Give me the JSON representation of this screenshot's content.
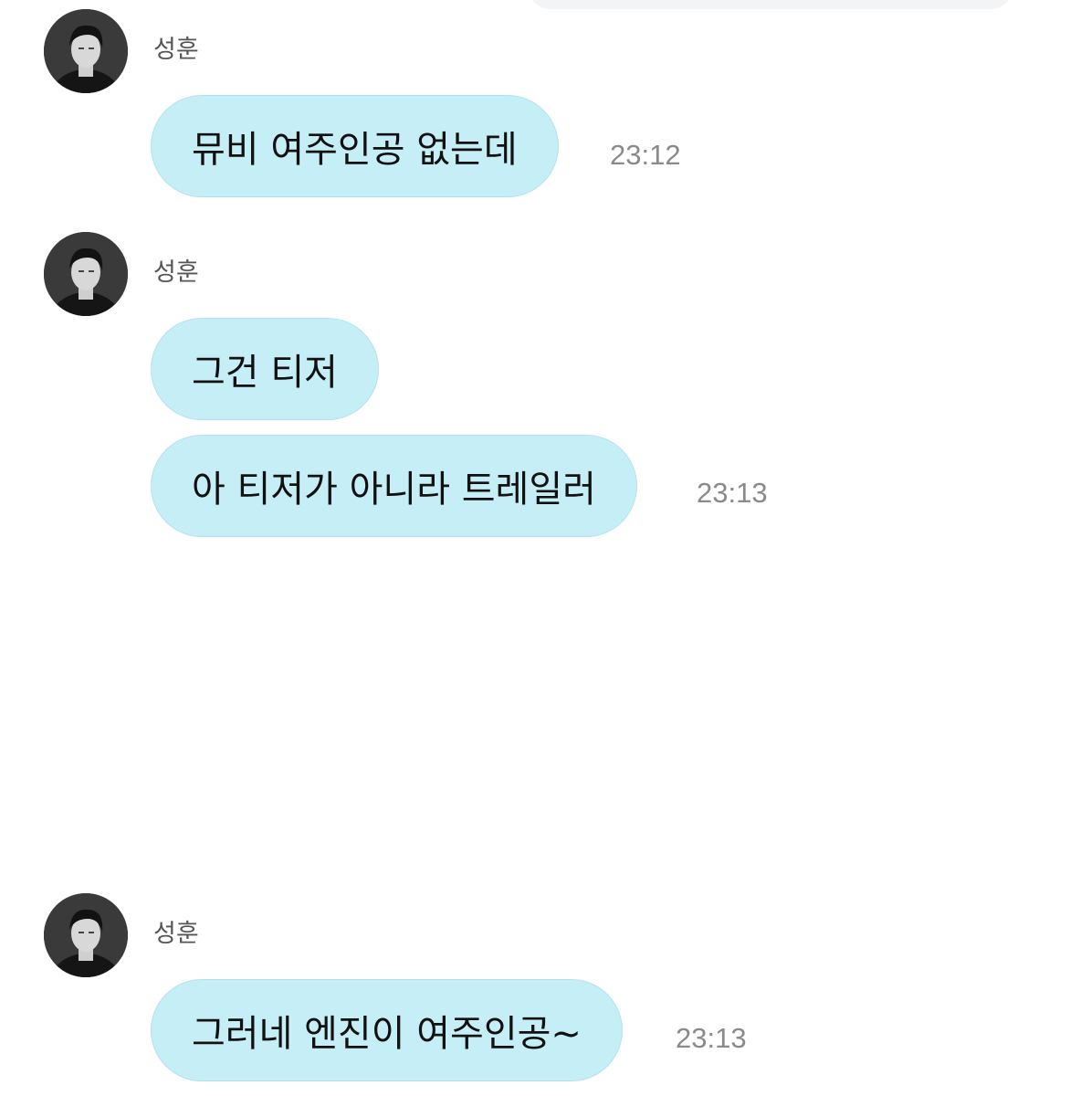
{
  "chat": {
    "groups": [
      {
        "sender": "성훈",
        "messages": [
          {
            "text": "뮤비 여주인공 없는데",
            "time": "23:12"
          }
        ]
      },
      {
        "sender": "성훈",
        "messages": [
          {
            "text": "그건 티저",
            "time": ""
          },
          {
            "text": "아 티저가 아니라 트레일러",
            "time": "23:13"
          }
        ]
      },
      {
        "sender": "성훈",
        "messages": [
          {
            "text": "그러네 엔진이 여주인공~",
            "time": "23:13"
          }
        ]
      }
    ]
  },
  "colors": {
    "bubble_background": "#c6eef6",
    "timestamp": "#8a8a8a",
    "sender_name": "#555555"
  },
  "icons": {
    "avatar": "profile-photo"
  }
}
